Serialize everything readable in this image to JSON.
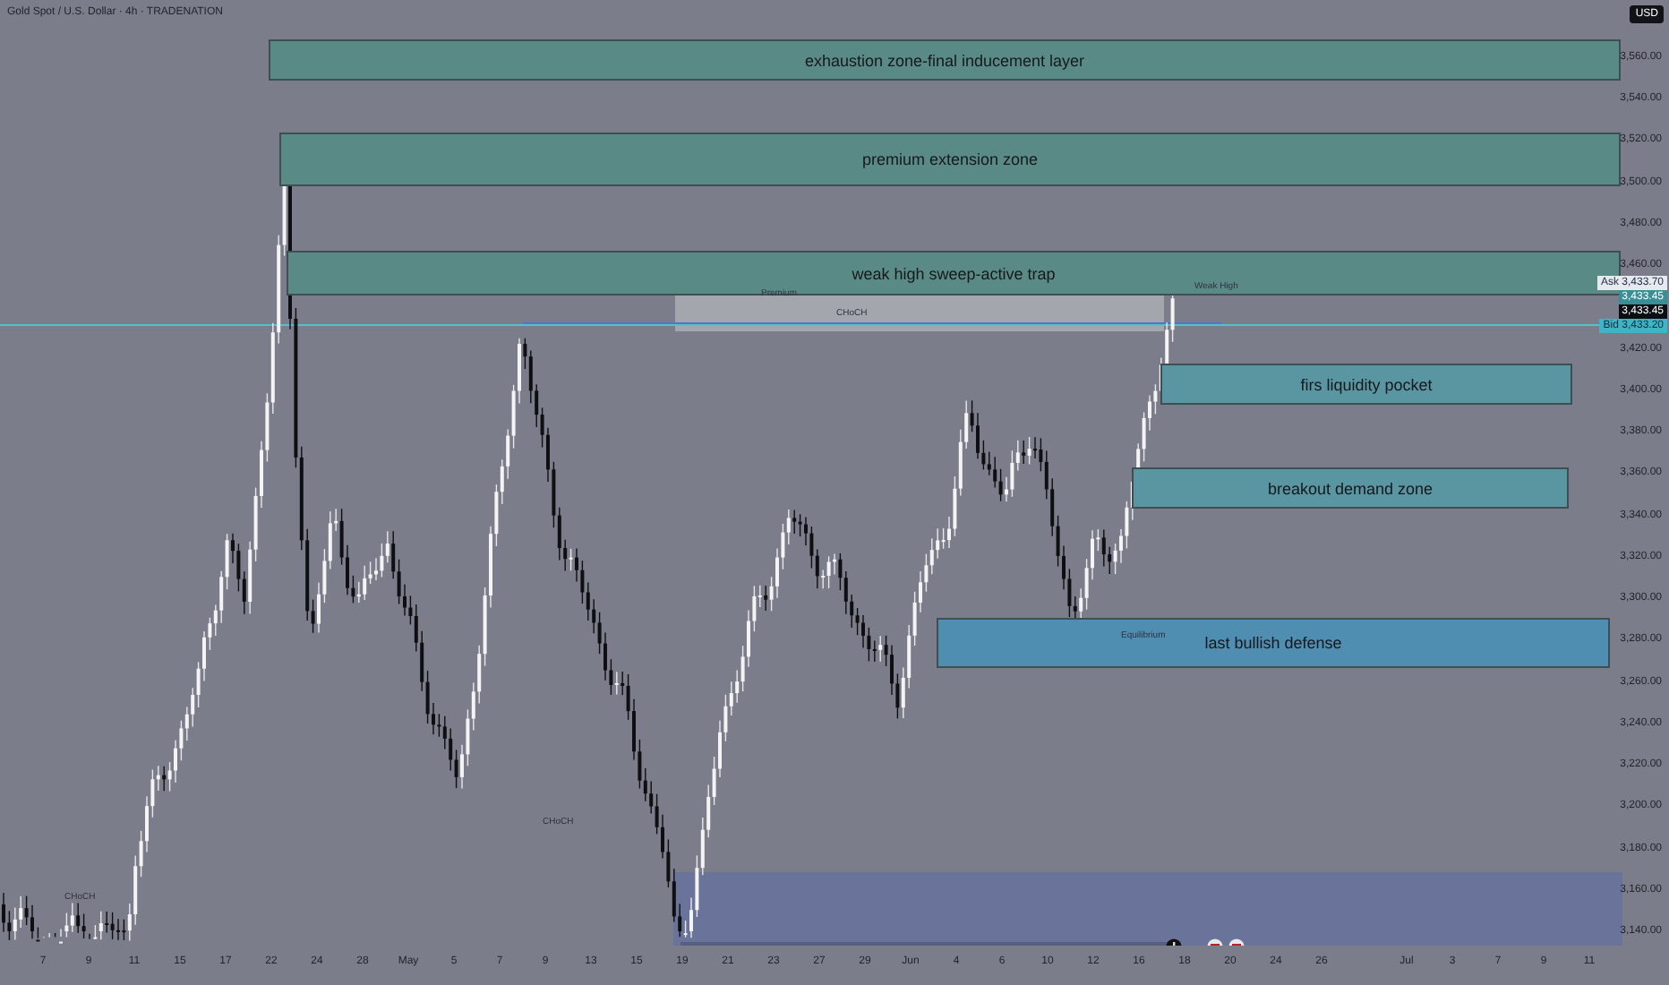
{
  "header": {
    "symbol": "Gold Spot / U.S. Dollar · 4h · TRADENATION",
    "currency": "USD"
  },
  "zones": [
    {
      "label": "exhaustion zone-final inducement layer",
      "color": "#5a8a86"
    },
    {
      "label": "premium extension zone",
      "color": "#5a8a86"
    },
    {
      "label": "weak high sweep-active trap",
      "color": "#5a8a86"
    },
    {
      "label": "firs liquidity pocket",
      "color": "#5a96a2"
    },
    {
      "label": "breakout demand zone",
      "color": "#5a96a2"
    },
    {
      "label": "last bullish defense",
      "color": "#4f8db1"
    }
  ],
  "markers": [
    "Premium",
    "CHoCH",
    "Weak High",
    "Equilibrium",
    "CHoCH",
    "CHoCH"
  ],
  "price_axis": {
    "labels": [
      "3,560.00",
      "3,540.00",
      "3,520.00",
      "3,500.00",
      "3,480.00",
      "3,460.00",
      "3,420.00",
      "3,400.00",
      "3,380.00",
      "3,360.00",
      "3,340.00",
      "3,320.00",
      "3,300.00",
      "3,280.00",
      "3,260.00",
      "3,240.00",
      "3,220.00",
      "3,200.00",
      "3,180.00",
      "3,160.00",
      "3,140.00"
    ],
    "quotes": [
      {
        "kind": "ask",
        "tag": "Ask",
        "price": "3,433.70"
      },
      {
        "kind": "mark",
        "price": "3,433.45"
      },
      {
        "kind": "last",
        "price": "3,433.45"
      },
      {
        "kind": "bid",
        "tag": "Bid",
        "price": "3,433.20"
      }
    ]
  },
  "time_axis": {
    "labels": [
      "7",
      "9",
      "11",
      "15",
      "17",
      "22",
      "24",
      "28",
      "May",
      "5",
      "7",
      "9",
      "13",
      "15",
      "19",
      "21",
      "23",
      "27",
      "29",
      "Jun",
      "4",
      "6",
      "10",
      "12",
      "16",
      "18",
      "20",
      "24",
      "26",
      "Jul",
      "3",
      "7",
      "9",
      "11"
    ]
  }
}
